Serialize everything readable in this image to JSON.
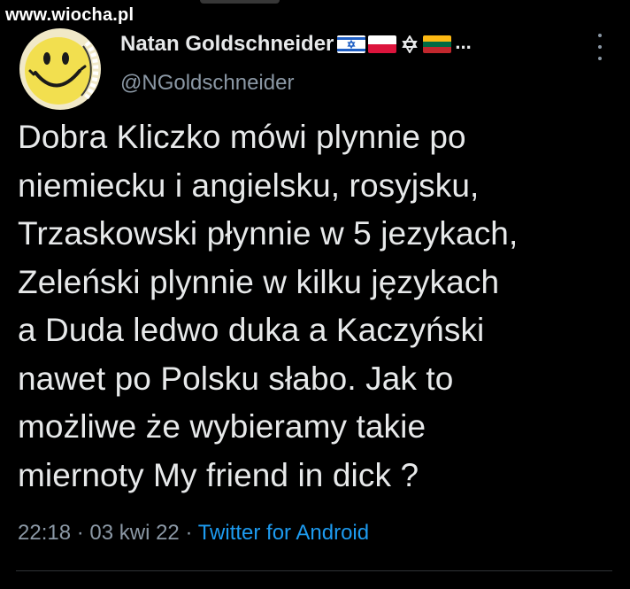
{
  "watermark": "www.wiocha.pl",
  "author": {
    "display_name": "Natan Goldschneider",
    "handle": "@NGoldschneider",
    "name_suffix": "...",
    "flags": [
      "israel-flag",
      "poland-flag",
      "star-of-david-icon",
      "lithuania-flag"
    ]
  },
  "tweet": {
    "text": "Dobra Kliczko mówi plynnie po\nniemiecku i angielsku, rosyjsku,\nTrzaskowski płynnie w 5 jezykach,\nZeleński plynnie w kilku językach\na Duda ledwo duka a Kaczyński\nnawet po Polsku słabo. Jak to\nmożliwe że wybieramy takie\nmiernoty My friend in dick ?",
    "time": "22:18",
    "sep1": " · ",
    "date": "03 kwi 22",
    "sep2": " · ",
    "source": "Twitter for Android"
  },
  "icons": {
    "more": "more-vertical-icon"
  },
  "colors": {
    "background": "#000000",
    "text": "#e7e9ea",
    "secondary": "#8b98a5",
    "link": "#1d9bf0",
    "divider": "#2f3336"
  }
}
